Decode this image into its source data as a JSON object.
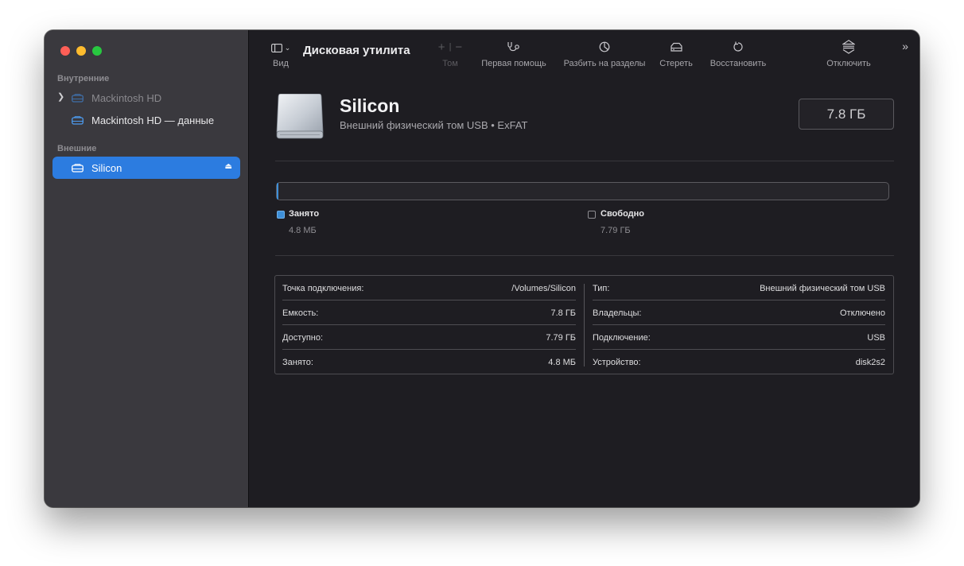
{
  "sidebar": {
    "internal_header": "Внутренние",
    "external_header": "Внешние",
    "items": [
      {
        "label": "Mackintosh HD",
        "icon": "disk-icon"
      },
      {
        "label": "Mackintosh HD — данные",
        "icon": "disk-icon"
      },
      {
        "label": "Silicon",
        "icon": "disk-icon",
        "selected": true
      }
    ]
  },
  "toolbar": {
    "view_label": "Вид",
    "app_title": "Дисковая утилита",
    "volume_label": "Том",
    "first_aid_label": "Первая помощь",
    "partition_label": "Разбить на разделы",
    "erase_label": "Стереть",
    "restore_label": "Восстановить",
    "unmount_label": "Отключить"
  },
  "volume": {
    "name": "Silicon",
    "description": "Внешний физический том USB • ExFAT",
    "size": "7.8 ГБ"
  },
  "usage": {
    "used_label": "Занято",
    "used_value": "4.8 МБ",
    "free_label": "Свободно",
    "free_value": "7.79 ГБ",
    "used_fraction": 0.0006
  },
  "info": {
    "left": [
      {
        "key": "Точка подключения:",
        "value": "/Volumes/Silicon"
      },
      {
        "key": "Емкость:",
        "value": "7.8 ГБ"
      },
      {
        "key": "Доступно:",
        "value": "7.79 ГБ"
      },
      {
        "key": "Занято:",
        "value": "4.8 МБ"
      }
    ],
    "right": [
      {
        "key": "Тип:",
        "value": "Внешний физический том USB"
      },
      {
        "key": "Владельцы:",
        "value": "Отключено"
      },
      {
        "key": "Подключение:",
        "value": "USB"
      },
      {
        "key": "Устройство:",
        "value": "disk2s2"
      }
    ]
  },
  "colors": {
    "accent": "#2c7ce0",
    "sidebar_bg": "#3a393e",
    "content_bg": "#1e1d22",
    "used_color": "#3e8fd8"
  }
}
